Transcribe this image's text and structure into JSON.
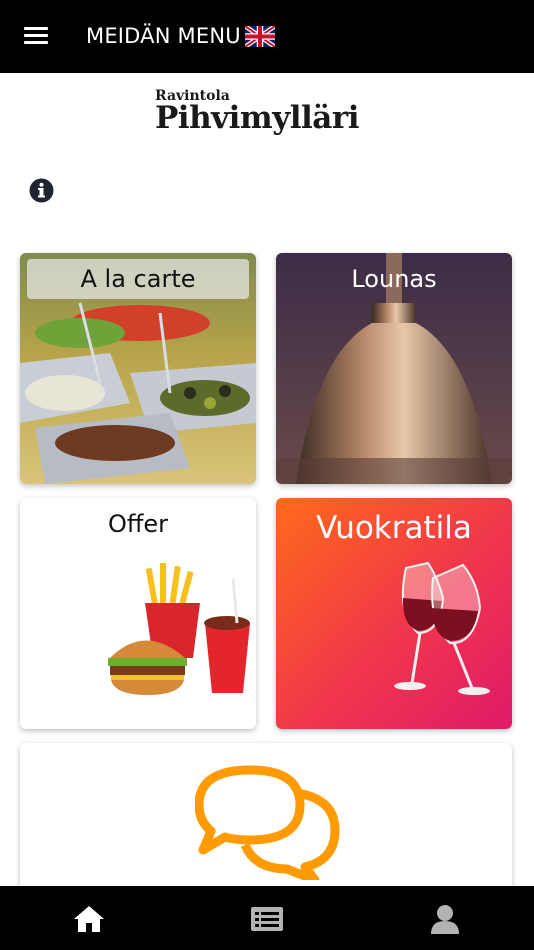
{
  "header": {
    "title": "MEIDÄN MENU",
    "menu_icon": "hamburger-menu-icon",
    "flag_icon": "uk-flag-icon"
  },
  "logo": {
    "line1": "Ravintola",
    "line2": "Pihvimylläri"
  },
  "info_icon": "info-icon",
  "cards": [
    {
      "label": "A la carte",
      "image": "salad-bar-photo"
    },
    {
      "label": "Lounas",
      "image": "copper-lamp-photo"
    },
    {
      "label": "Offer",
      "image": "burger-fries-drink-illustration"
    },
    {
      "label": "Vuokratila",
      "image": "wine-glasses-illustration"
    },
    {
      "label": "",
      "image": "chat-bubbles-icon"
    }
  ],
  "bottom_nav": [
    {
      "icon": "home-icon"
    },
    {
      "icon": "list-icon"
    },
    {
      "icon": "profile-icon"
    }
  ],
  "colors": {
    "header_bg": "#000000",
    "accent_orange": "#ff9800",
    "rental_gradient_start": "#ff6a1a",
    "rental_gradient_end": "#e01a6a"
  }
}
